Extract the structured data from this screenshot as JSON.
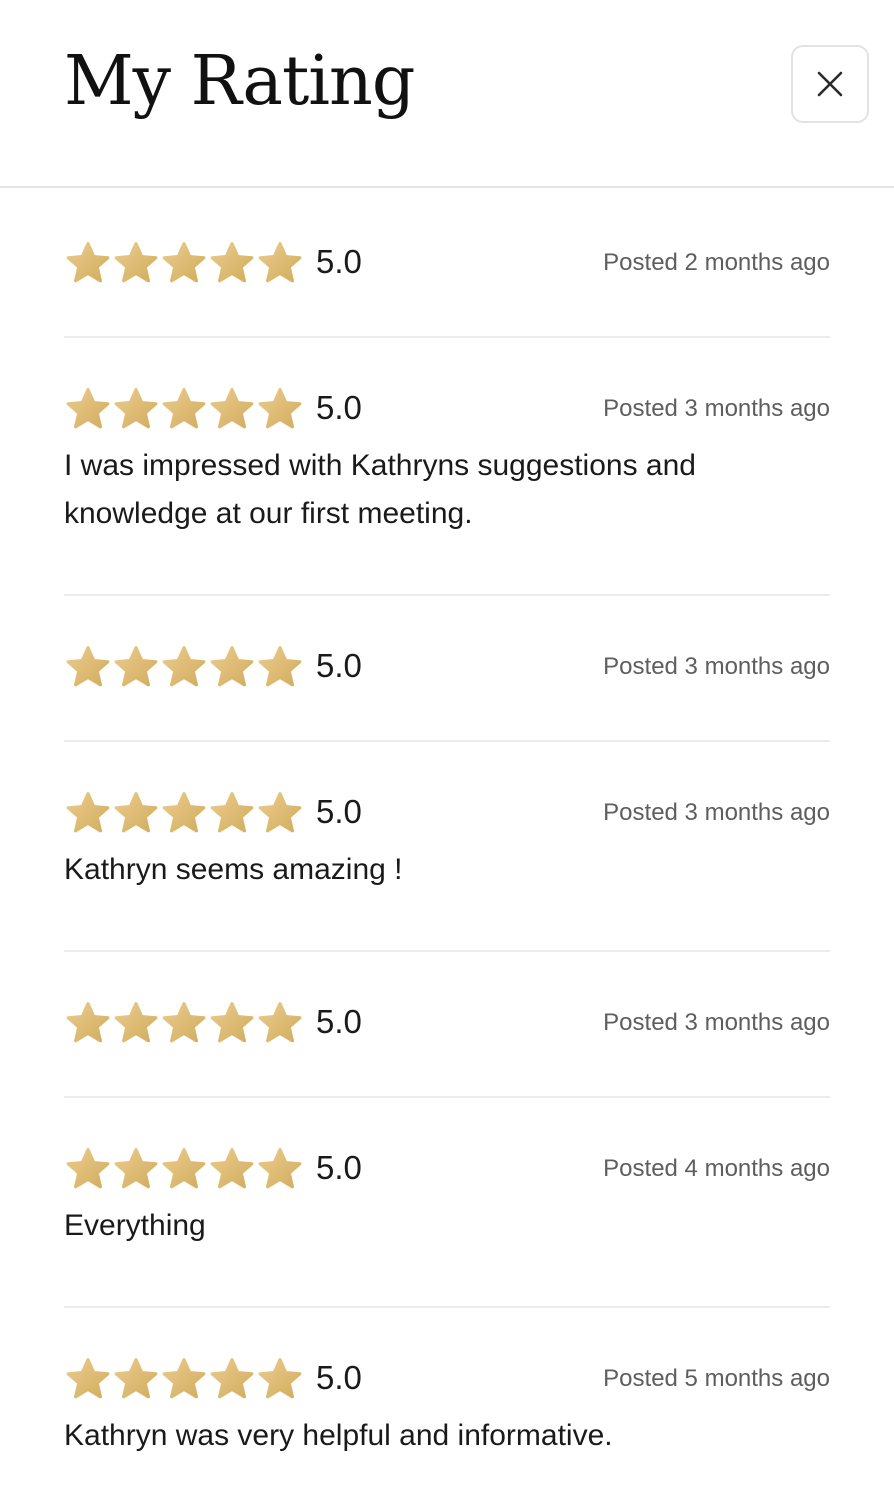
{
  "header": {
    "title": "My Rating",
    "close_icon": "close-icon"
  },
  "star_colors": {
    "light": "#EBCB8D",
    "dark": "#D2AD5E"
  },
  "reviews": [
    {
      "rating": 5,
      "score": "5.0",
      "posted": "Posted 2 months ago",
      "comment": ""
    },
    {
      "rating": 5,
      "score": "5.0",
      "posted": "Posted 3 months ago",
      "comment": "I was impressed with Kathryns suggestions and knowledge at our first meeting."
    },
    {
      "rating": 5,
      "score": "5.0",
      "posted": "Posted 3 months ago",
      "comment": ""
    },
    {
      "rating": 5,
      "score": "5.0",
      "posted": "Posted 3 months ago",
      "comment": "Kathryn seems amazing !"
    },
    {
      "rating": 5,
      "score": "5.0",
      "posted": "Posted 3 months ago",
      "comment": ""
    },
    {
      "rating": 5,
      "score": "5.0",
      "posted": "Posted 4 months ago",
      "comment": "Everything"
    },
    {
      "rating": 5,
      "score": "5.0",
      "posted": "Posted 5 months ago",
      "comment": "Kathryn was very helpful and informative."
    }
  ]
}
